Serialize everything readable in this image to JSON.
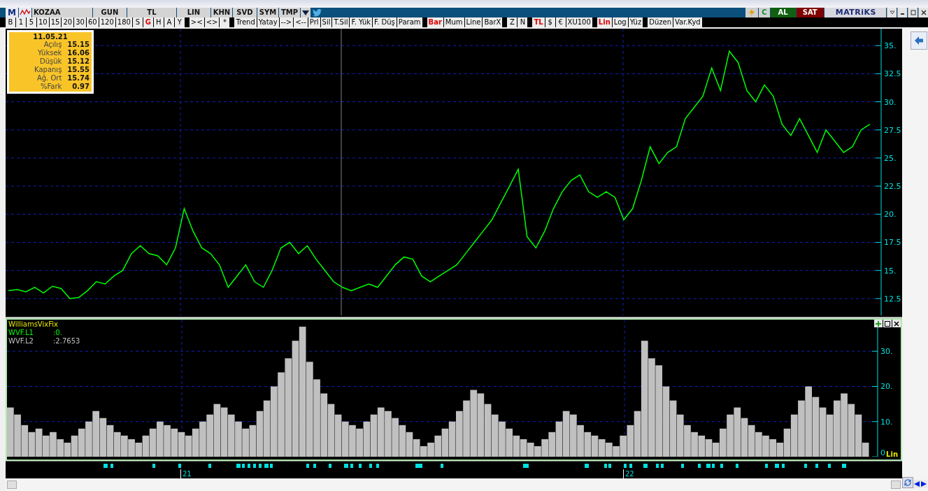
{
  "symbol_bar": {
    "logo": "M",
    "symbol": "KOZAA",
    "buttons": [
      "GUN",
      "TL",
      "LIN",
      "KHN",
      "SVD",
      "SYM",
      "TMP"
    ]
  },
  "trade_buttons": [
    {
      "label": "C",
      "kind": "refresh"
    },
    {
      "label": "AL",
      "kind": "buy"
    },
    {
      "label": "SAT",
      "kind": "sell"
    }
  ],
  "brand": "MATRiKS",
  "period_bar": [
    [
      {
        "label": "B",
        "selected": false
      },
      {
        "label": "1",
        "selected": false
      },
      {
        "label": "5",
        "selected": false
      },
      {
        "label": "10",
        "selected": false
      },
      {
        "label": "15",
        "selected": false
      },
      {
        "label": "20",
        "selected": false
      },
      {
        "label": "30",
        "selected": false
      },
      {
        "label": "60",
        "selected": false
      },
      {
        "label": "120",
        "selected": false
      },
      {
        "label": "180",
        "selected": false
      },
      {
        "label": "S",
        "selected": false
      },
      {
        "label": "G",
        "selected": true
      },
      {
        "label": "H",
        "selected": false
      },
      {
        "label": "A",
        "selected": false
      },
      {
        "label": "Y",
        "selected": false
      }
    ],
    [
      {
        "label": "><",
        "selected": false
      },
      {
        "label": "<>",
        "selected": false
      },
      {
        "label": "*",
        "selected": false
      }
    ],
    [
      {
        "label": "Trend",
        "selected": false
      },
      {
        "label": "Yatay",
        "selected": false
      },
      {
        "label": "-->",
        "selected": false
      },
      {
        "label": "<--",
        "selected": false
      },
      {
        "label": "Prl",
        "selected": false
      },
      {
        "label": "Sil",
        "selected": false
      },
      {
        "label": "T.Sil",
        "selected": false
      },
      {
        "label": "F. Yük",
        "selected": false
      },
      {
        "label": "F. Düş",
        "selected": false
      },
      {
        "label": "Param",
        "selected": false
      }
    ],
    [
      {
        "label": "Bar",
        "selected": true
      },
      {
        "label": "Mum",
        "selected": false
      },
      {
        "label": "Line",
        "selected": false
      },
      {
        "label": "BarX",
        "selected": false
      }
    ],
    [
      {
        "label": "Z",
        "selected": false
      },
      {
        "label": "N",
        "selected": false
      }
    ],
    [
      {
        "label": "TL",
        "selected": true
      },
      {
        "label": "$",
        "selected": false
      },
      {
        "label": "€",
        "selected": false
      },
      {
        "label": "XU100",
        "selected": false
      }
    ],
    [
      {
        "label": "Lin",
        "selected": true
      },
      {
        "label": "Log",
        "selected": false
      },
      {
        "label": "Yüz",
        "selected": false
      }
    ],
    [
      {
        "label": "Düzen",
        "selected": false
      },
      {
        "label": "Var.Kyd",
        "selected": false
      }
    ]
  ],
  "info_box": {
    "date": "11.05.21",
    "rows": [
      {
        "label": "Açılış",
        "value": "15.15"
      },
      {
        "label": "Yüksek",
        "value": "16.06"
      },
      {
        "label": "Düşük",
        "value": "15.12"
      },
      {
        "label": "Kapanış",
        "value": "15.55"
      },
      {
        "label": "Ağ. Ort",
        "value": "15.74"
      },
      {
        "label": "%Fark",
        "value": "0.97"
      }
    ]
  },
  "price_chart": {
    "chart_data": {
      "type": "line",
      "ylim": [
        11,
        36.5
      ],
      "grid": true,
      "yticks": [
        {
          "value": 12.5,
          "label": "12.5"
        },
        {
          "value": 15,
          "label": "15."
        },
        {
          "value": 17.5,
          "label": "17.5"
        },
        {
          "value": 20,
          "label": "20."
        },
        {
          "value": 22.5,
          "label": "22.5"
        },
        {
          "value": 25,
          "label": "25."
        },
        {
          "value": 27.5,
          "label": "27.5"
        },
        {
          "value": 30,
          "label": "30."
        },
        {
          "value": 32.5,
          "label": "32.5"
        },
        {
          "value": 35,
          "label": "35."
        }
      ],
      "series": [
        {
          "color": "#00ff00",
          "values": [
            13.2,
            13.3,
            13.1,
            13.5,
            13.0,
            13.6,
            13.4,
            12.5,
            12.6,
            13.2,
            14.0,
            13.8,
            14.5,
            15.0,
            16.5,
            17.2,
            16.5,
            16.3,
            15.5,
            17.0,
            20.5,
            18.5,
            17.0,
            16.5,
            15.5,
            13.5,
            14.5,
            15.5,
            14.0,
            13.5,
            15.0,
            17.0,
            17.5,
            16.5,
            17.2,
            16.0,
            15.0,
            14.0,
            13.5,
            13.2,
            13.5,
            13.8,
            13.5,
            14.5,
            15.5,
            16.2,
            16.0,
            14.5,
            14.0,
            14.5,
            15.0,
            15.5,
            16.5,
            17.5,
            18.5,
            19.5,
            21.0,
            22.5,
            24.0,
            18.0,
            17.0,
            18.5,
            20.5,
            22.0,
            23.0,
            23.5,
            22.0,
            21.5,
            22.0,
            21.5,
            19.5,
            20.5,
            23.0,
            26.0,
            24.5,
            25.5,
            26.0,
            28.5,
            29.5,
            30.5,
            33.0,
            31.0,
            34.5,
            33.5,
            31.0,
            30.0,
            31.5,
            30.5,
            28.0,
            27.0,
            28.5,
            27.0,
            25.5,
            27.5,
            26.5,
            25.5,
            26.0,
            27.5,
            28.0
          ]
        }
      ]
    }
  },
  "indicator": {
    "title": "WilliamsVixFix",
    "lines": [
      {
        "name": "WVF.L1",
        "value": ":0.",
        "color": "#00ff00"
      },
      {
        "name": "WVF.L2",
        "value": ":2.7653",
        "color": "#c0c0c0"
      }
    ],
    "scale": "Lin",
    "chart_data": {
      "type": "bar",
      "ylim": [
        0,
        39
      ],
      "grid": true,
      "yticks": [
        {
          "value": 0,
          "label": "0"
        },
        {
          "value": 10,
          "label": "10."
        },
        {
          "value": 20,
          "label": "20."
        },
        {
          "value": 30,
          "label": "30."
        }
      ],
      "series": [
        {
          "color": "#c0c0c0",
          "values": [
            14,
            12,
            9,
            7,
            8,
            6,
            7,
            5,
            4,
            6,
            8,
            10,
            13,
            11,
            9,
            7,
            6,
            5,
            4,
            6,
            8,
            10,
            9,
            8,
            7,
            6,
            8,
            10,
            12,
            15,
            14,
            12,
            10,
            8,
            9,
            13,
            16,
            20,
            24,
            28,
            33,
            37,
            27,
            22,
            18,
            15,
            12,
            10,
            9,
            8,
            10,
            12,
            14,
            13,
            11,
            9,
            7,
            5,
            3,
            4,
            6,
            8,
            10,
            13,
            16,
            19,
            18,
            15,
            12,
            10,
            8,
            6,
            5,
            4,
            3,
            5,
            7,
            10,
            13,
            12,
            9,
            7,
            6,
            5,
            4,
            3,
            6,
            9,
            13,
            33,
            28,
            26,
            20,
            16,
            12,
            9,
            7,
            6,
            5,
            4,
            8,
            12,
            14,
            11,
            9,
            7,
            6,
            5,
            4,
            8,
            12,
            16,
            20,
            17,
            14,
            12,
            16,
            18,
            15,
            12,
            4
          ]
        }
      ]
    }
  },
  "time_axis": {
    "labels": [
      "21",
      "22"
    ]
  }
}
